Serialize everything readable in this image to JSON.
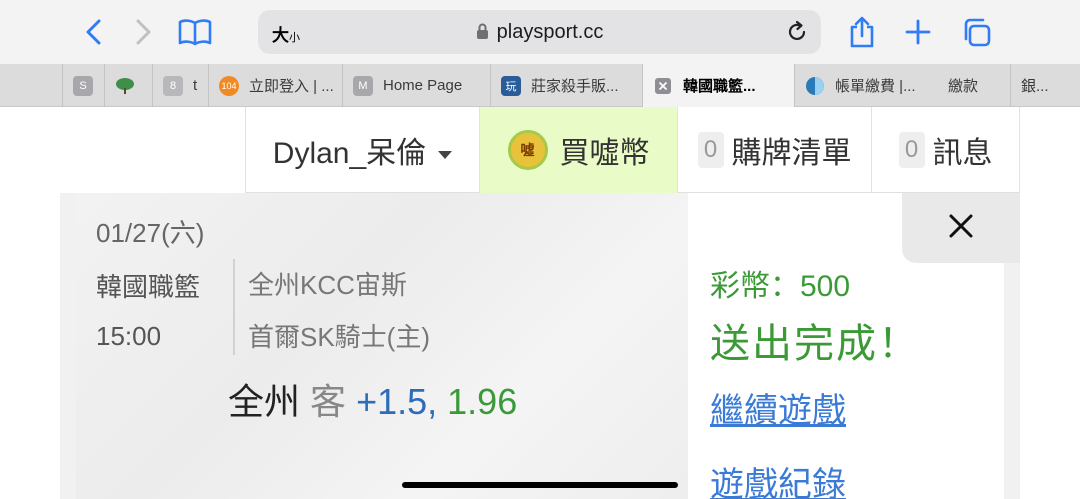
{
  "browser": {
    "text_size_label": "大",
    "text_size_small": "小",
    "url": "playsport.cc",
    "icons": [
      "back-icon",
      "forward-icon",
      "bookmarks-icon",
      "lock-icon",
      "reload-icon",
      "share-icon",
      "new-tab-icon",
      "tabs-icon"
    ],
    "tabs": [
      {
        "favicon": "S",
        "label": ""
      },
      {
        "favicon": "tree",
        "label": ""
      },
      {
        "favicon": "8",
        "label": "t"
      },
      {
        "favicon": "104",
        "label": "立即登入 | ..."
      },
      {
        "favicon": "M",
        "label": "Home Page"
      },
      {
        "favicon": "玩",
        "label": "莊家殺手販..."
      },
      {
        "favicon": "close",
        "label": "韓國職籃..."
      },
      {
        "favicon": "globe",
        "label": "帳單繳費 |..."
      },
      {
        "favicon": "",
        "label": "繳款"
      },
      {
        "favicon": "",
        "label": "銀..."
      }
    ]
  },
  "header": {
    "user_name": "Dylan_呆倫",
    "coin_icon_text": "噓",
    "buy_label": "買噓幣",
    "cart_count": "0",
    "cart_label": "購牌清單",
    "msg_count": "0",
    "msg_label": "訊息"
  },
  "game": {
    "date": "01/27(六)",
    "league": "韓國職籃",
    "time": "15:00",
    "away_team": "全州KCC宙斯",
    "home_team": "首爾SK騎士(主)",
    "pick_team": "全州",
    "pick_side": "客",
    "pick_line": "+1.5,",
    "pick_odds": "1.96"
  },
  "result": {
    "coins": "彩幣：500",
    "status": "送出完成！",
    "continue_link": "繼續遊戲",
    "history_link": "遊戲紀錄"
  },
  "colors": {
    "green": "#3c9a36",
    "link_blue": "#3b7bd6",
    "buy_bg": "#e9fcc7"
  }
}
